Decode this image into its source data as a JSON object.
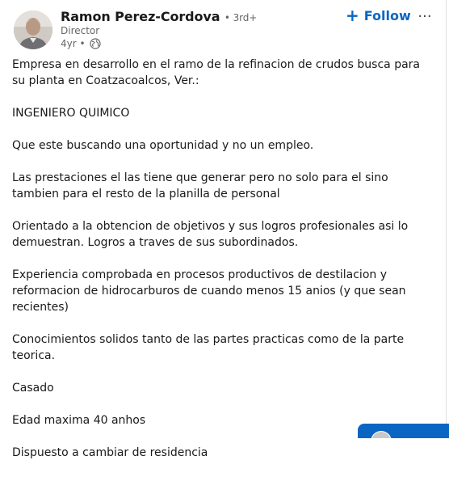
{
  "author": {
    "name": "Ramon Perez-Cordova",
    "degree": "• 3rd+",
    "headline": "Director",
    "time": "4yr •",
    "visibility_icon": "globe-icon"
  },
  "actions": {
    "follow_label": "Follow",
    "follow_icon": "plus-icon",
    "more_icon": "more-dots-icon",
    "more_label": "···"
  },
  "post": {
    "paragraphs": [
      "Empresa en desarrollo en el ramo de la refinacion de crudos busca para su planta en Coatzacoalcos, Ver.:",
      "INGENIERO QUIMICO",
      "Que este buscando una oportunidad y no un empleo.",
      "Las prestaciones el las tiene que generar pero no solo para el sino tambien para el resto de la planilla de personal",
      "Orientado a la obtencion de objetivos y sus logros profesionales asi lo demuestran. Logros a traves de sus subordinados.",
      "Experiencia comprobada en procesos productivos de destilacion y reformacion de hidrocarburos de cuando menos 15 anios (y que sean recientes)",
      "Conocimientos solidos tanto de las partes practicas como de la parte teorica.",
      "Casado",
      "Edad maxima 40 anhos",
      "Dispuesto a cambiar de residencia"
    ]
  },
  "colors": {
    "accent": "#0a66c2",
    "text": "#191919",
    "muted": "#666666"
  }
}
